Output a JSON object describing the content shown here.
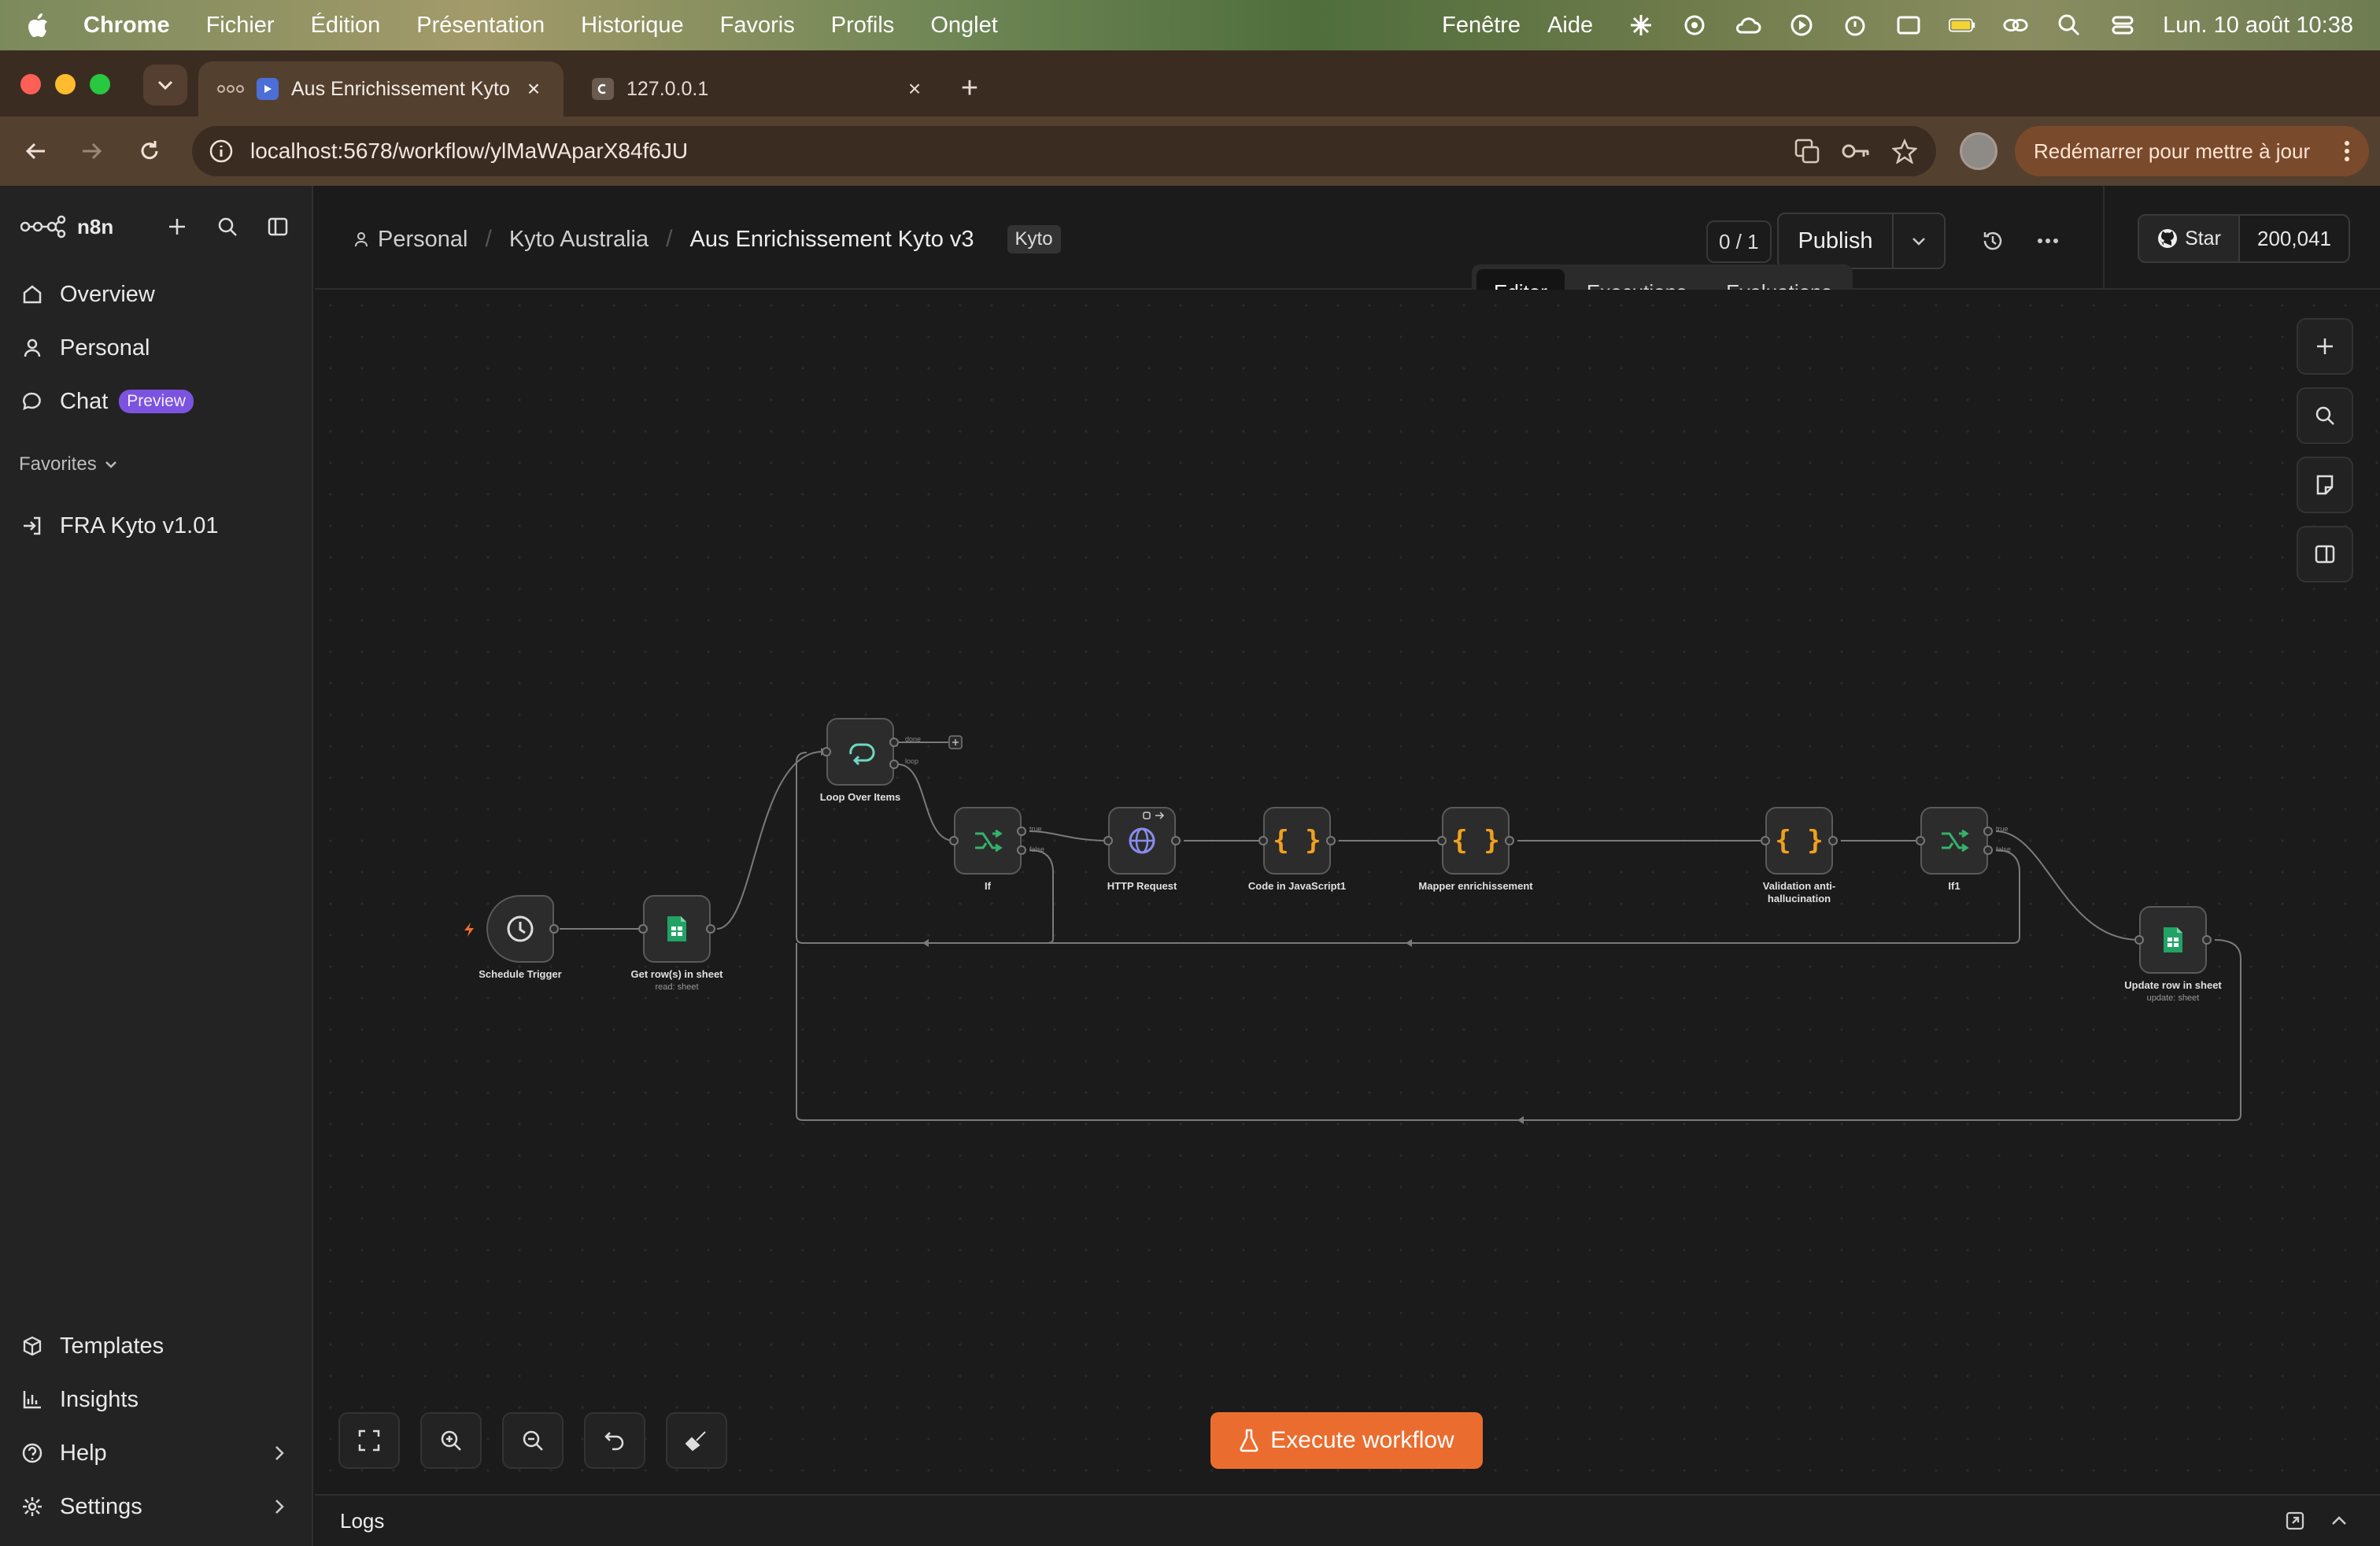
{
  "menubar": {
    "app": "Chrome",
    "items": [
      "Fichier",
      "Édition",
      "Présentation",
      "Historique",
      "Favoris",
      "Profils",
      "Onglet"
    ],
    "right_items": [
      "Fenêtre",
      "Aide"
    ],
    "clock": "Lun. 10 août  10:38"
  },
  "browser": {
    "tabs": [
      {
        "title": "Aus Enrichissement Kyto v",
        "active": true
      },
      {
        "title": "127.0.0.1",
        "active": false
      }
    ],
    "url": "localhost:5678/workflow/ylMaWAparX84f6JU",
    "update_button": "Redémarrer pour mettre à jour"
  },
  "sidebar": {
    "brand": "n8n",
    "items": [
      {
        "label": "Overview",
        "icon": "home-icon"
      },
      {
        "label": "Personal",
        "icon": "user-icon"
      },
      {
        "label": "Chat",
        "icon": "chat-icon",
        "badge": "Preview"
      }
    ],
    "favorites_label": "Favorites",
    "favorites": [
      {
        "label": "FRA Kyto v1.01",
        "icon": "enter-icon"
      }
    ],
    "bottom": [
      {
        "label": "Templates",
        "icon": "box-icon"
      },
      {
        "label": "Insights",
        "icon": "chart-icon"
      },
      {
        "label": "Help",
        "icon": "help-icon"
      },
      {
        "label": "Settings",
        "icon": "gear-icon"
      }
    ]
  },
  "header": {
    "breadcrumbs": [
      "Personal",
      "Kyto Australia",
      "Aus Enrichissement Kyto v3"
    ],
    "tag": "Kyto",
    "versions": "0 / 1",
    "publish": "Publish",
    "github_star": "Star",
    "github_count": "200,041"
  },
  "modes": [
    "Editor",
    "Executions",
    "Evaluations"
  ],
  "nodes": [
    {
      "label": "Schedule Trigger",
      "sub": "",
      "icon": "clock-icon"
    },
    {
      "label": "Get row(s) in sheet",
      "sub": "read: sheet",
      "icon": "sheets-icon"
    },
    {
      "label": "Loop Over Items",
      "sub": "",
      "icon": "loop-icon"
    },
    {
      "label": "If",
      "sub": "",
      "icon": "branch-icon"
    },
    {
      "label": "HTTP Request",
      "sub": "",
      "icon": "globe-icon"
    },
    {
      "label": "Code in JavaScript1",
      "sub": "",
      "icon": "braces-icon"
    },
    {
      "label": "Mapper enrichissement",
      "sub": "",
      "icon": "braces-icon"
    },
    {
      "label": "Validation anti-hallucination",
      "sub": "",
      "icon": "braces-icon"
    },
    {
      "label": "If1",
      "sub": "",
      "icon": "branch-icon"
    },
    {
      "label": "Update row in sheet",
      "sub": "update: sheet",
      "icon": "sheets-icon"
    }
  ],
  "edge_labels": {
    "done": "done",
    "loop": "loop",
    "true": "true",
    "false": "false"
  },
  "execute_button": "Execute workflow",
  "logs_label": "Logs",
  "colors": {
    "accent": "#ea6d2f",
    "sheets": "#21a366",
    "code": "#f0a020",
    "branch": "#35b36a",
    "http": "#8a8cf0"
  }
}
